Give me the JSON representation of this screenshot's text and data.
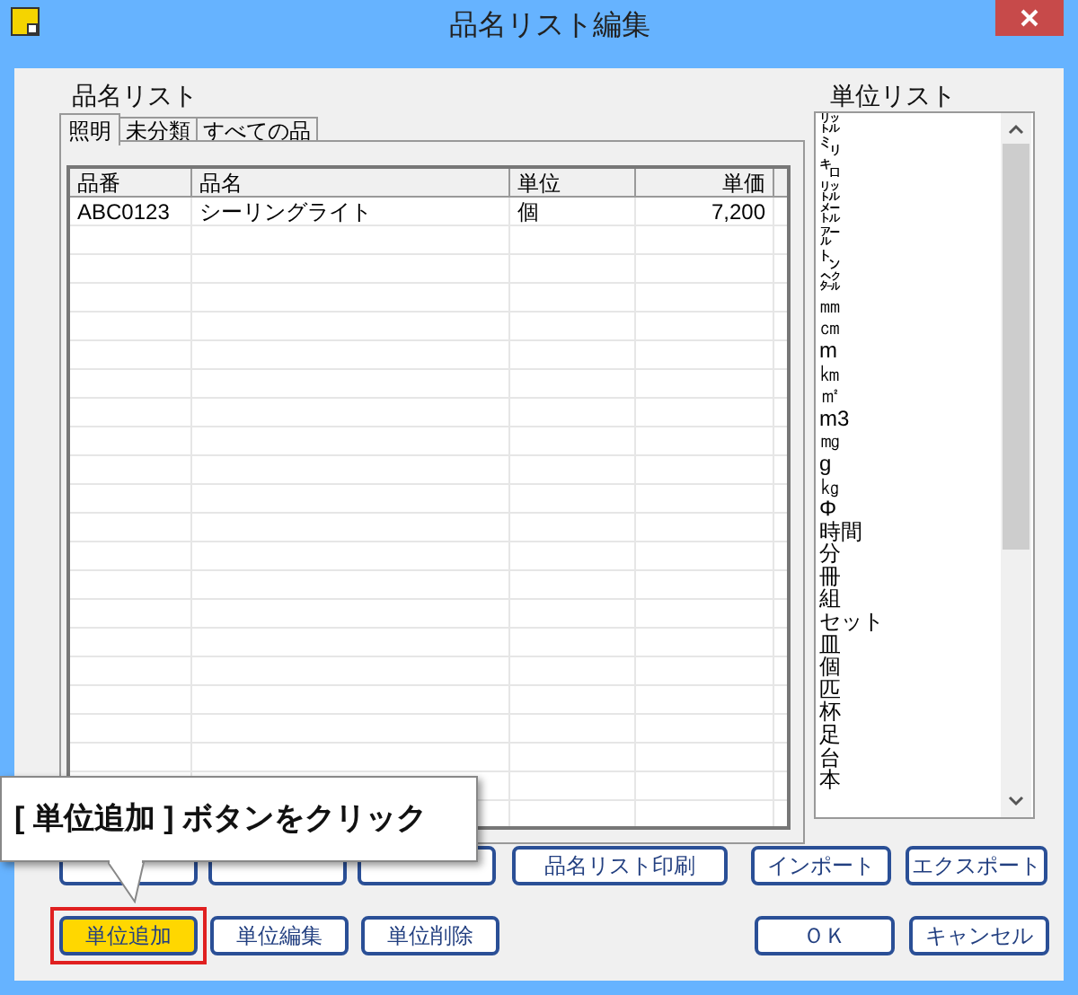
{
  "window": {
    "title": "品名リスト編集"
  },
  "item_list": {
    "label": "品名リスト",
    "tabs": [
      {
        "label": "照明",
        "selected": true
      },
      {
        "label": "未分類",
        "selected": false
      },
      {
        "label": "すべての品",
        "selected": false
      }
    ],
    "columns": [
      "品番",
      "品名",
      "単位",
      "単価"
    ],
    "rows": [
      {
        "cells": [
          "ABC0123",
          "シーリングライト",
          "個",
          "7,200"
        ]
      }
    ]
  },
  "unit_list": {
    "label": "単位リスト",
    "items": [
      "㍑",
      "㍉",
      "㌔",
      "㍑",
      "㍍",
      "㌃",
      "㌧",
      "㌶",
      "㎜",
      "㎝",
      "m",
      "㎞",
      "㎡",
      "m3",
      "㎎",
      "g",
      "㎏",
      "Φ",
      "時間",
      "分",
      "冊",
      "組",
      "セット",
      "皿",
      "個",
      "匹",
      "杯",
      "足",
      "台",
      "本"
    ]
  },
  "covered_buttons": [
    {
      "kind": "button"
    },
    {
      "kind": "button"
    },
    {
      "kind": "button"
    }
  ],
  "buttons_row1": [
    {
      "label": "品名リスト印刷"
    },
    {
      "label": "インポート"
    },
    {
      "label": "エクスポート"
    }
  ],
  "buttons_row2": [
    {
      "label": "単位追加",
      "highlighted": true
    },
    {
      "label": "単位編集",
      "highlighted": false
    },
    {
      "label": "単位削除",
      "highlighted": false
    }
  ],
  "dialog_buttons": [
    {
      "label": "ＯＫ"
    },
    {
      "label": "キャンセル"
    }
  ],
  "callout": {
    "text": "[ 単位追加 ] ボタンをクリック"
  }
}
